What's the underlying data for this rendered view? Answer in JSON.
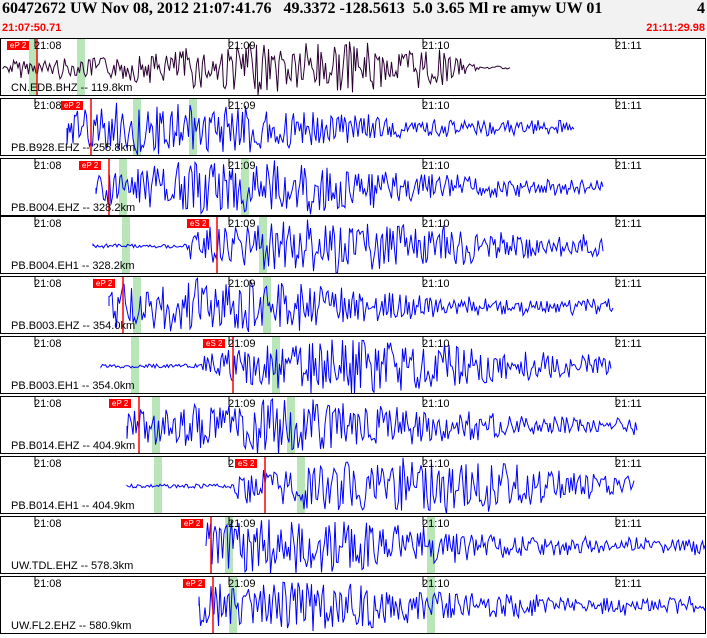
{
  "header": {
    "title": "60472672 UW Nov 08, 2012 21:07:41.76   49.3372 -128.5613  5.0 3.65 Ml re amyw UW 01",
    "page_number": "4",
    "start_time": "21:07:50.71",
    "end_time": "21:11:29.98"
  },
  "time_axis": {
    "ticks": [
      "21:08",
      "21:09",
      "21:10",
      "21:11"
    ]
  },
  "colors": {
    "trace_primary": "#0000ff",
    "trace_first": "#2a0033",
    "pick": "#ff0000",
    "window_marker": "#b8e6b8",
    "header_time": "#ff0000"
  },
  "panels": [
    {
      "label": "CN.EDB.BHZ -- 119.8km",
      "pick": "eP 2",
      "color": "#2a0033"
    },
    {
      "label": "PB.B928.EHZ -- 255.8km",
      "pick": "eP 2",
      "color": "#0000ff"
    },
    {
      "label": "PB.B004.EHZ -- 328.2km",
      "pick": "eP 2",
      "color": "#0000ff"
    },
    {
      "label": "PB.B004.EH1 -- 328.2km",
      "pick": "eS 2",
      "color": "#0000ff"
    },
    {
      "label": "PB.B003.EHZ -- 354.0km",
      "pick": "eP 2",
      "color": "#0000ff"
    },
    {
      "label": "PB.B003.EH1 -- 354.0km",
      "pick": "eS 2",
      "color": "#0000ff"
    },
    {
      "label": "PB.B014.EHZ -- 404.9km",
      "pick": "eP 2",
      "color": "#0000ff"
    },
    {
      "label": "PB.B014.EH1 -- 404.9km",
      "pick": "eS 2",
      "color": "#0000ff"
    },
    {
      "label": "UW.TDL.EHZ -- 578.3km",
      "pick": "eP 2",
      "color": "#0000ff"
    },
    {
      "label": "UW.FL2.EHZ -- 580.9km",
      "pick": "eP 2",
      "color": "#0000ff"
    }
  ]
}
